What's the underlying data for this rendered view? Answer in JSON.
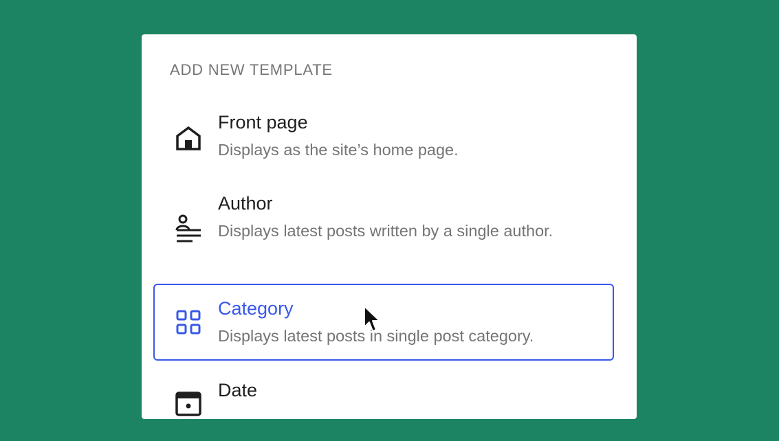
{
  "panel": {
    "heading": "ADD NEW TEMPLATE",
    "items": [
      {
        "id": "front-page",
        "title": "Front page",
        "description": "Displays as the site’s home page.",
        "icon": "home-icon"
      },
      {
        "id": "author",
        "title": "Author",
        "description": "Displays latest posts written by a single author.",
        "icon": "author-icon"
      },
      {
        "id": "category",
        "title": "Category",
        "description": "Displays latest posts in single post category.",
        "icon": "category-grid-icon",
        "selected": true
      },
      {
        "id": "date",
        "title": "Date",
        "description": "",
        "icon": "calendar-icon"
      }
    ]
  },
  "colors": {
    "background": "#1c8462",
    "accent": "#3858e9",
    "text_primary": "#1e1e1e",
    "text_secondary": "#757575"
  }
}
